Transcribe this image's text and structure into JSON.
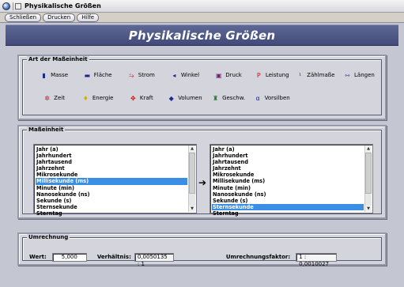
{
  "window": {
    "title": "Physikalische Größen"
  },
  "menu": [
    "Schließen",
    "Drucken",
    "Hilfe"
  ],
  "header": {
    "title": "Physikalische Größen"
  },
  "unit_types": {
    "legend": "Art der Maßeinheit",
    "items": [
      {
        "label": "Masse",
        "icon": "mass-icon",
        "glyph": "▮",
        "color": "#1a2a8a"
      },
      {
        "label": "Fläche",
        "icon": "area-icon",
        "glyph": "▬",
        "color": "#1a2a8a"
      },
      {
        "label": "Strom",
        "icon": "current-icon",
        "glyph": "⥲",
        "color": "#c01818"
      },
      {
        "label": "Winkel",
        "icon": "angle-icon",
        "glyph": "◂",
        "color": "#1a2a8a"
      },
      {
        "label": "Druck",
        "icon": "pressure-icon",
        "glyph": "▣",
        "color": "#7a1a7a"
      },
      {
        "label": "Leistung",
        "icon": "power-icon",
        "glyph": "P",
        "color": "#c01818"
      },
      {
        "label": "Zählmaße",
        "icon": "count-icon",
        "glyph": "¹",
        "color": "#1a2a8a"
      },
      {
        "label": "Längen",
        "icon": "length-icon",
        "glyph": "⇿",
        "color": "#1a2a8a"
      },
      {
        "label": "Zeit",
        "icon": "clock-icon",
        "glyph": "✲",
        "color": "#c01818"
      },
      {
        "label": "Energie",
        "icon": "energy-icon",
        "glyph": "♦",
        "color": "#d8b000"
      },
      {
        "label": "Kraft",
        "icon": "force-icon",
        "glyph": "✥",
        "color": "#c01818"
      },
      {
        "label": "Volumen",
        "icon": "volume-icon",
        "glyph": "◆",
        "color": "#1a2a8a"
      },
      {
        "label": "Geschw.",
        "icon": "speed-icon",
        "glyph": "♜",
        "color": "#2a7a2a"
      },
      {
        "label": "Vorsilben",
        "icon": "prefix-icon",
        "glyph": "α",
        "color": "#1a2a8a"
      }
    ]
  },
  "units": {
    "legend": "Maßeinheit",
    "left_list": [
      "Jahr (a)",
      "Jahrhundert",
      "Jahrtausend",
      "Jahrzehnt",
      "Mikrosekunde",
      "Millisekunde (ms)",
      "Minute (min)",
      "Nanosekunde (ns)",
      "Sekunde (s)",
      "Sternsekunde",
      "Sterntag"
    ],
    "left_selected": 5,
    "right_list": [
      "Jahr (a)",
      "Jahrhundert",
      "Jahrtausend",
      "Jahrzehnt",
      "Mikrosekunde",
      "Millisekunde (ms)",
      "Minute (min)",
      "Nanosekunde (ns)",
      "Sekunde (s)",
      "Sternsekunde",
      "Sterntag"
    ],
    "right_selected": 9,
    "arrow": "➔"
  },
  "conversion": {
    "legend": "Umrechnung",
    "value_label": "Wert:",
    "value": "5,000",
    "ratio_label": "Verhältnis:",
    "ratio": "0,0050135 : 1",
    "factor_label": "Umrechnungsfaktor:",
    "factor": "1 : 0,0010027"
  },
  "colors": {
    "header_bg": "#4a5480",
    "selection": "#3a8ee6",
    "panel_bg": "#d4d4dc"
  }
}
